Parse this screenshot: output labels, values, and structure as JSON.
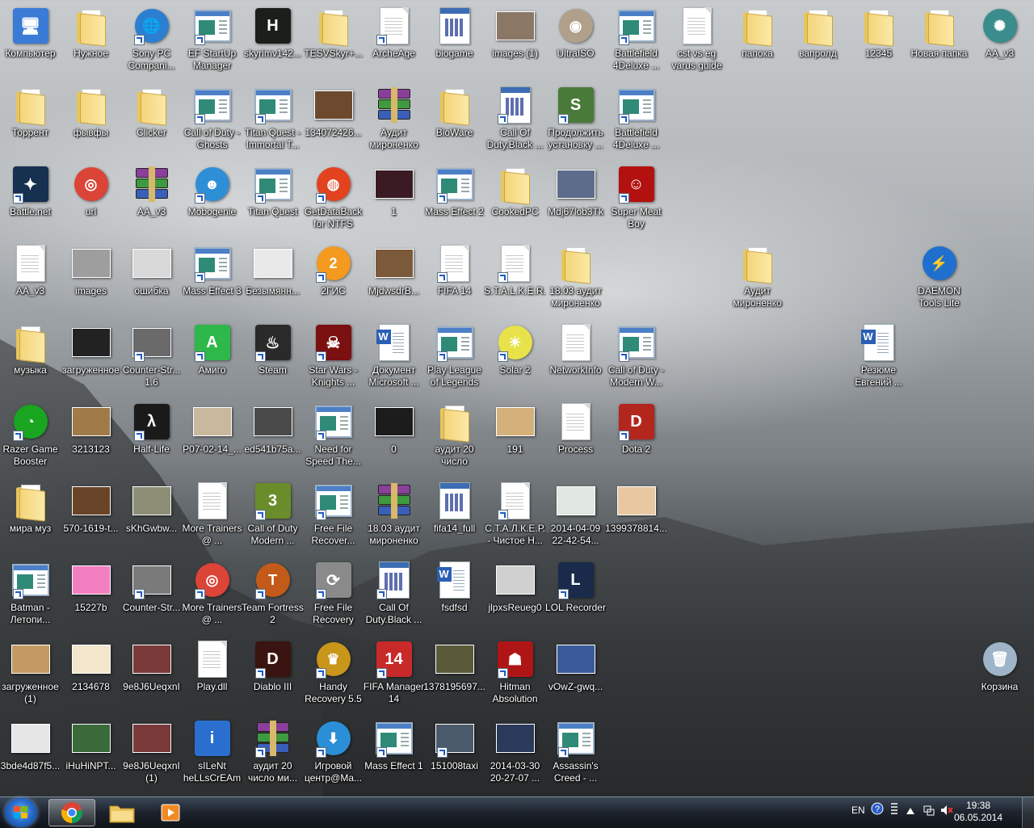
{
  "desktop_icons": [
    {
      "label": "Компьютер",
      "kind": "sq",
      "color": "#3a7bd5",
      "glyph": "🖥",
      "shortcut": false
    },
    {
      "label": "Нужное",
      "kind": "folder",
      "shortcut": false
    },
    {
      "label": "Sony PC Compani...",
      "kind": "round",
      "color": "#2b7fd1",
      "glyph": "🌐",
      "shortcut": true
    },
    {
      "label": "EF StartUp Manager",
      "kind": "app",
      "shortcut": true
    },
    {
      "label": "skyrimv142...",
      "kind": "sq",
      "color": "#1b1f1b",
      "glyph": "H",
      "shortcut": false
    },
    {
      "label": "TESVSkyr+...",
      "kind": "folder",
      "shortcut": false
    },
    {
      "label": "ArcheAge",
      "kind": "file",
      "shortcut": true
    },
    {
      "label": "biogame",
      "kind": "cal",
      "shortcut": false
    },
    {
      "label": "images (1)",
      "kind": "photo",
      "color": "#8a7766",
      "shortcut": false
    },
    {
      "label": "UltraISO",
      "kind": "round",
      "color": "#b0a08a",
      "glyph": "◉",
      "shortcut": false
    },
    {
      "label": "Battlefield 4Deluxe ...",
      "kind": "app",
      "shortcut": true
    },
    {
      "label": "cst vs eg varus guide",
      "kind": "file",
      "shortcut": false
    },
    {
      "label": "папока",
      "kind": "folder",
      "shortcut": false
    },
    {
      "label": "вапролд",
      "kind": "folder",
      "shortcut": false
    },
    {
      "label": "12345",
      "kind": "folder",
      "shortcut": false
    },
    {
      "label": "Новая папка",
      "kind": "folder",
      "shortcut": false
    },
    {
      "label": "AA_v3",
      "kind": "round",
      "color": "#3b8c8c",
      "glyph": "✺",
      "shortcut": false
    },
    {
      "label": "Торрент",
      "kind": "folder",
      "shortcut": false
    },
    {
      "label": "фывфы",
      "kind": "folder",
      "shortcut": false
    },
    {
      "label": "Clicker",
      "kind": "folder",
      "shortcut": false
    },
    {
      "label": "Call of Duty - Ghosts",
      "kind": "app",
      "shortcut": true
    },
    {
      "label": "Titan Quest - Immortal T...",
      "kind": "app",
      "shortcut": true
    },
    {
      "label": "134072426...",
      "kind": "photo",
      "color": "#6b4a2f",
      "shortcut": false
    },
    {
      "label": "Аудит мироненко",
      "kind": "rar",
      "shortcut": false
    },
    {
      "label": "BioWare",
      "kind": "folder",
      "shortcut": false
    },
    {
      "label": "Call Of Duty.Black ...",
      "kind": "cal",
      "shortcut": true
    },
    {
      "label": "Продолжить установку ...",
      "kind": "sq",
      "color": "#4a7a3a",
      "glyph": "S",
      "shortcut": true
    },
    {
      "label": "Battlefield 4Deluxe ...",
      "kind": "app",
      "shortcut": true
    },
    {
      "label": "Battle.net",
      "kind": "sq",
      "color": "#16304f",
      "glyph": "✦",
      "shortcut": true
    },
    {
      "label": "url",
      "kind": "round",
      "color": "#db4437",
      "glyph": "◎",
      "shortcut": false
    },
    {
      "label": "AA_v3",
      "kind": "rar",
      "shortcut": false
    },
    {
      "label": "Mobogenie",
      "kind": "round",
      "color": "#2f8fd6",
      "glyph": "☻",
      "shortcut": true
    },
    {
      "label": "Titan Quest",
      "kind": "app",
      "shortcut": true
    },
    {
      "label": "GetDataBack for NTFS",
      "kind": "round",
      "color": "#e2431e",
      "glyph": "◍",
      "shortcut": true
    },
    {
      "label": "1",
      "kind": "photo",
      "color": "#3a1b24",
      "shortcut": false
    },
    {
      "label": "Mass Effect 2",
      "kind": "app",
      "shortcut": true
    },
    {
      "label": "CookedPC",
      "kind": "folder",
      "shortcut": false
    },
    {
      "label": "Mdj67lob3Tk",
      "kind": "photo",
      "color": "#5d6c8a",
      "shortcut": false
    },
    {
      "label": "Super Meat Boy",
      "kind": "sq",
      "color": "#b31010",
      "glyph": "☺",
      "shortcut": true
    },
    {
      "label": "AA_v3",
      "kind": "file",
      "shortcut": false
    },
    {
      "label": "images",
      "kind": "photo",
      "color": "#9e9e9e",
      "shortcut": false
    },
    {
      "label": "ошибка",
      "kind": "photo",
      "color": "#d8d8d8",
      "shortcut": false
    },
    {
      "label": "Mass Effect 3",
      "kind": "app",
      "shortcut": true
    },
    {
      "label": "Безымянн...",
      "kind": "photo",
      "color": "#e9e9e9",
      "shortcut": false
    },
    {
      "label": "2ГИС",
      "kind": "round",
      "color": "#f39a1f",
      "glyph": "2",
      "shortcut": true
    },
    {
      "label": "MjdwsdrB...",
      "kind": "photo",
      "color": "#7a5a3a",
      "shortcut": false
    },
    {
      "label": "FIFA 14",
      "kind": "file",
      "shortcut": true
    },
    {
      "label": "S.T.A.L.K.E.R.",
      "kind": "file",
      "shortcut": true
    },
    {
      "label": "18.03 аудит мироненко",
      "kind": "folder",
      "shortcut": false
    },
    {
      "label": "Аудит мироненко",
      "kind": "folder",
      "shortcut": false
    },
    {
      "label": "DAEMON Tools Lite",
      "kind": "round",
      "color": "#1f6fcf",
      "glyph": "⚡",
      "shortcut": false
    },
    {
      "label": "музыка",
      "kind": "folder",
      "shortcut": false
    },
    {
      "label": "загруженное",
      "kind": "photo",
      "color": "#222222",
      "shortcut": false
    },
    {
      "label": "Counter-Str... 1.6",
      "kind": "photo",
      "color": "#6a6a6a",
      "shortcut": true
    },
    {
      "label": "Амиго",
      "kind": "sq",
      "color": "#2fb84a",
      "glyph": "A",
      "shortcut": true
    },
    {
      "label": "Steam",
      "kind": "sq",
      "color": "#2a2a2a",
      "glyph": "♨",
      "shortcut": true
    },
    {
      "label": "Star Wars - Knights ...",
      "kind": "sq",
      "color": "#7a1010",
      "glyph": "☠",
      "shortcut": true
    },
    {
      "label": "Документ Microsoft ...",
      "kind": "word",
      "shortcut": false
    },
    {
      "label": "Play League of Legends",
      "kind": "app",
      "shortcut": true
    },
    {
      "label": "Solar 2",
      "kind": "round",
      "color": "#e8e24a",
      "glyph": "☀",
      "shortcut": true
    },
    {
      "label": "NetworkInfo",
      "kind": "file",
      "shortcut": false
    },
    {
      "label": "Call of Duty - Modern W...",
      "kind": "app",
      "shortcut": true
    },
    {
      "label": "Резюме Евгений ...",
      "kind": "word",
      "shortcut": false
    },
    {
      "label": "Razer Game Booster",
      "kind": "round",
      "color": "#19a51f",
      "glyph": "◔",
      "shortcut": true
    },
    {
      "label": "3213123",
      "kind": "photo",
      "color": "#a07b4a",
      "shortcut": false
    },
    {
      "label": "Half-Life",
      "kind": "sq",
      "color": "#1a1a1a",
      "glyph": "λ",
      "shortcut": true
    },
    {
      "label": "P07-02-14_...",
      "kind": "photo",
      "color": "#c9b79e",
      "shortcut": false
    },
    {
      "label": "ed541b75a...",
      "kind": "photo",
      "color": "#4a4a4a",
      "shortcut": false
    },
    {
      "label": "Need for Speed The...",
      "kind": "app",
      "shortcut": true
    },
    {
      "label": "0",
      "kind": "photo",
      "color": "#1c1c1c",
      "shortcut": false
    },
    {
      "label": "аудит 20 число",
      "kind": "folder",
      "shortcut": false
    },
    {
      "label": "191",
      "kind": "photo",
      "color": "#d4b07a",
      "shortcut": false
    },
    {
      "label": "Process",
      "kind": "file",
      "shortcut": false
    },
    {
      "label": "Dota 2",
      "kind": "sq",
      "color": "#b3261e",
      "glyph": "D",
      "shortcut": true
    },
    {
      "label": "мира муз",
      "kind": "folder",
      "shortcut": false
    },
    {
      "label": "570-1619-t...",
      "kind": "photo",
      "color": "#6a4428",
      "shortcut": false
    },
    {
      "label": "sKhGwbw...",
      "kind": "photo",
      "color": "#8c8f76",
      "shortcut": false
    },
    {
      "label": "More Trainers @ ...",
      "kind": "file",
      "shortcut": false
    },
    {
      "label": "Call of Duty Modern ...",
      "kind": "sq",
      "color": "#6a8c2a",
      "glyph": "3",
      "shortcut": true
    },
    {
      "label": "Free File Recover...",
      "kind": "app",
      "shortcut": true
    },
    {
      "label": "18.03 аудит мироненко",
      "kind": "rar",
      "shortcut": false
    },
    {
      "label": "fifa14_full",
      "kind": "cal",
      "shortcut": false
    },
    {
      "label": "С.Т.А.Л.К.Е.Р. - Чистое Н...",
      "kind": "file",
      "shortcut": true
    },
    {
      "label": "2014-04-09 22-42-54...",
      "kind": "photo",
      "color": "#e0e6e0",
      "shortcut": false
    },
    {
      "label": "1399378814...",
      "kind": "photo",
      "color": "#e8c8a0",
      "shortcut": false
    },
    {
      "label": "Batman - Летопи...",
      "kind": "app",
      "shortcut": true
    },
    {
      "label": "15227b",
      "kind": "photo",
      "color": "#f27fc0",
      "shortcut": false
    },
    {
      "label": "Counter-Str...",
      "kind": "photo",
      "color": "#7a7a7a",
      "shortcut": true
    },
    {
      "label": "More Trainers @ ...",
      "kind": "round",
      "color": "#db4437",
      "glyph": "◎",
      "shortcut": true
    },
    {
      "label": "Team Fortress 2",
      "kind": "round",
      "color": "#c35a1a",
      "glyph": "T",
      "shortcut": true
    },
    {
      "label": "Free File Recovery",
      "kind": "sq",
      "color": "#8a8a8a",
      "glyph": "⟳",
      "shortcut": true
    },
    {
      "label": "Call Of Duty.Black ...",
      "kind": "cal",
      "shortcut": true
    },
    {
      "label": "fsdfsd",
      "kind": "word",
      "shortcut": false
    },
    {
      "label": "jlpxsReueg0",
      "kind": "photo",
      "color": "#d0d0d0",
      "shortcut": false
    },
    {
      "label": "LOL Recorder",
      "kind": "sq",
      "color": "#1a2a4a",
      "glyph": "L",
      "shortcut": true
    },
    {
      "label": "загруженное (1)",
      "kind": "photo",
      "color": "#c39a62",
      "shortcut": false
    },
    {
      "label": "2134678",
      "kind": "photo",
      "color": "#f4e6cc",
      "shortcut": false
    },
    {
      "label": "9e8J6UeqxnI",
      "kind": "photo",
      "color": "#7a3a3a",
      "shortcut": false
    },
    {
      "label": "Play.dll",
      "kind": "file",
      "shortcut": false
    },
    {
      "label": "Diablo III",
      "kind": "sq",
      "color": "#3a1410",
      "glyph": "D",
      "shortcut": true
    },
    {
      "label": "Handy Recovery 5.5",
      "kind": "round",
      "color": "#c9961a",
      "glyph": "♛",
      "shortcut": true
    },
    {
      "label": "FIFA Manager 14",
      "kind": "sq",
      "color": "#c82a2a",
      "glyph": "14",
      "shortcut": true
    },
    {
      "label": "1378195697...",
      "kind": "photo",
      "color": "#5a5a3a",
      "shortcut": false
    },
    {
      "label": "Hitman Absolution",
      "kind": "sq",
      "color": "#b01515",
      "glyph": "☗",
      "shortcut": true
    },
    {
      "label": "vOwZ-gwq...",
      "kind": "photo",
      "color": "#3a5a9a",
      "shortcut": false
    },
    {
      "label": "Корзина",
      "kind": "round",
      "color": "#9fb4c8",
      "glyph": "🗑",
      "shortcut": false
    },
    {
      "label": "3bde4d87f5...",
      "kind": "photo",
      "color": "#e6e6e6",
      "shortcut": false
    },
    {
      "label": "iHuHiNPT...",
      "kind": "photo",
      "color": "#3a6a3a",
      "shortcut": false
    },
    {
      "label": "9e8J6UeqxnI (1)",
      "kind": "photo",
      "color": "#7a3a3a",
      "shortcut": false
    },
    {
      "label": "sILeNt heLLsCrEAm",
      "kind": "sq",
      "color": "#2a6fcf",
      "glyph": "i",
      "shortcut": false
    },
    {
      "label": "аудит 20 число ми...",
      "kind": "rar",
      "shortcut": true
    },
    {
      "label": "Игровой центр@Ma...",
      "kind": "round",
      "color": "#2a8fd6",
      "glyph": "⬇",
      "shortcut": true
    },
    {
      "label": "Mass Effect 1",
      "kind": "app",
      "shortcut": true
    },
    {
      "label": "151008taxi",
      "kind": "photo",
      "color": "#4a5a6a",
      "shortcut": true
    },
    {
      "label": "2014-03-30 20-27-07 ...",
      "kind": "photo",
      "color": "#2a3a5a",
      "shortcut": false
    },
    {
      "label": "Assassin's Creed - ...",
      "kind": "app",
      "shortcut": true
    }
  ],
  "taskbar": {
    "start_button": "start",
    "pinned": [
      {
        "name": "chrome",
        "icon": "chrome-icon",
        "active": true
      },
      {
        "name": "explorer",
        "icon": "folder-icon",
        "active": false
      },
      {
        "name": "media",
        "icon": "media-player-icon",
        "active": false
      }
    ],
    "language": "EN",
    "clock_time": "19:38",
    "clock_date": "06.05.2014"
  }
}
